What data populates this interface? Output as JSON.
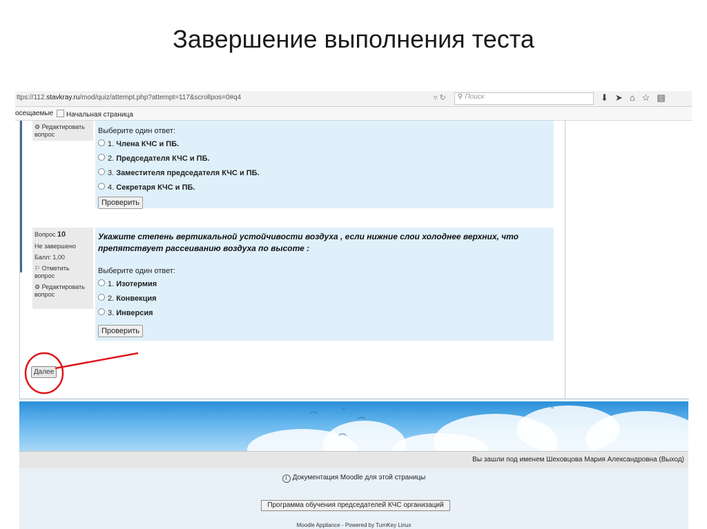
{
  "slide_title": "Завершение выполнения теста",
  "browser": {
    "url_prefix": "ttps://112.",
    "url_host": "stavkray.ru",
    "url_path": "/mod/quiz/attempt.php?attempt=117&scrollpos=0#q4",
    "search_placeholder": "Поиск",
    "bookmarks": [
      "осещаемые",
      "Начальная страница"
    ]
  },
  "question9": {
    "edit_label": "Редактировать",
    "edit_label2": "вопрос",
    "prompt": "Выберите один ответ:",
    "options": [
      {
        "num": "1.",
        "text": "Члена КЧС и ПБ."
      },
      {
        "num": "2.",
        "text": "Председателя КЧС и ПБ."
      },
      {
        "num": "3.",
        "text": "Заместителя председателя КЧС и ПБ."
      },
      {
        "num": "4.",
        "text": "Секретаря КЧС  и ПБ."
      }
    ],
    "check_label": "Проверить"
  },
  "question10": {
    "label": "Вопрос",
    "number": "10",
    "status": "Не завершено",
    "score": "Балл: 1,00",
    "flag_label": "Отметить",
    "flag_label2": "вопрос",
    "edit_label": "Редактировать",
    "edit_label2": "вопрос",
    "text_line1": "Укажите степень вертикальной устойчивости воздуха , если нижние слои холоднее верхних, что",
    "text_line2": "препятствует рассеиванию воздуха по высоте :",
    "prompt": "Выберите один ответ:",
    "options": [
      {
        "num": "1.",
        "text": "Изотермия"
      },
      {
        "num": "2.",
        "text": "Конвекция"
      },
      {
        "num": "3.",
        "text": "Инверсия"
      }
    ],
    "check_label": "Проверить"
  },
  "next_label": "Далее",
  "login": {
    "prefix": "Вы зашли под именем",
    "user": "Шеховцова Мария Александровна",
    "logout": "(Выход)"
  },
  "footer": {
    "doc_link": "Документация Moodle для этой страницы",
    "course_button": "Программа обучения председателей КЧС организаций",
    "powered": "Moodle Appliance - Powered by TurnKey Linux"
  },
  "colors": {
    "question_bg": "#dff0fb",
    "annotation": "#e0161b"
  }
}
